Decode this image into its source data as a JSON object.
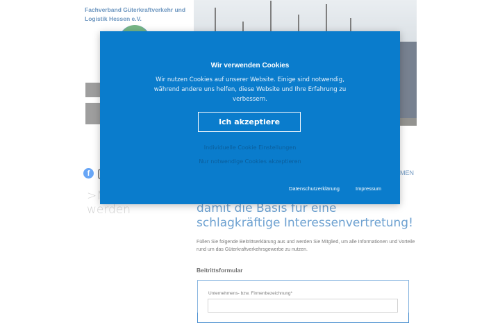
{
  "site": {
    "org_name_line1": "Fachverband Güterkraftverkehr und",
    "org_name_line2": "Logistik Hessen e.V.",
    "nav_tail": "MEN",
    "facebook_glyph": "f"
  },
  "content": {
    "left_heading_line1": ">M",
    "left_heading_line2": "werden",
    "main_heading_line1": "damit die Basis für eine",
    "main_heading_line2": "schlagkräftige Interessenvertretung!",
    "intro": "Füllen Sie folgende Beitrittserklärung aus und werden Sie Mitglied, um alle Informationen und Vorteile rund um das Güterkraftverkehrsgewerbe zu nutzen.",
    "form_title": "Beitrittsformular",
    "company_label": "Unternehmens- bzw. Firmenbezeichnung*"
  },
  "cookie_banner": {
    "title": "Wir verwenden Cookies",
    "text": "Wir nutzen Cookies auf unserer Website. Einige sind notwendig, während andere uns helfen, diese Website und Ihre Erfahrung zu verbessern.",
    "accept_label": "Ich akzeptiere",
    "individual_settings": "Individuelle Cookie Einstellungen",
    "only_necessary": "Nur notwendige Cookies akzeptieren",
    "privacy_link": "Datenschutzerklärung",
    "imprint_link": "Impressum",
    "background_color": "#0a7ccc"
  }
}
